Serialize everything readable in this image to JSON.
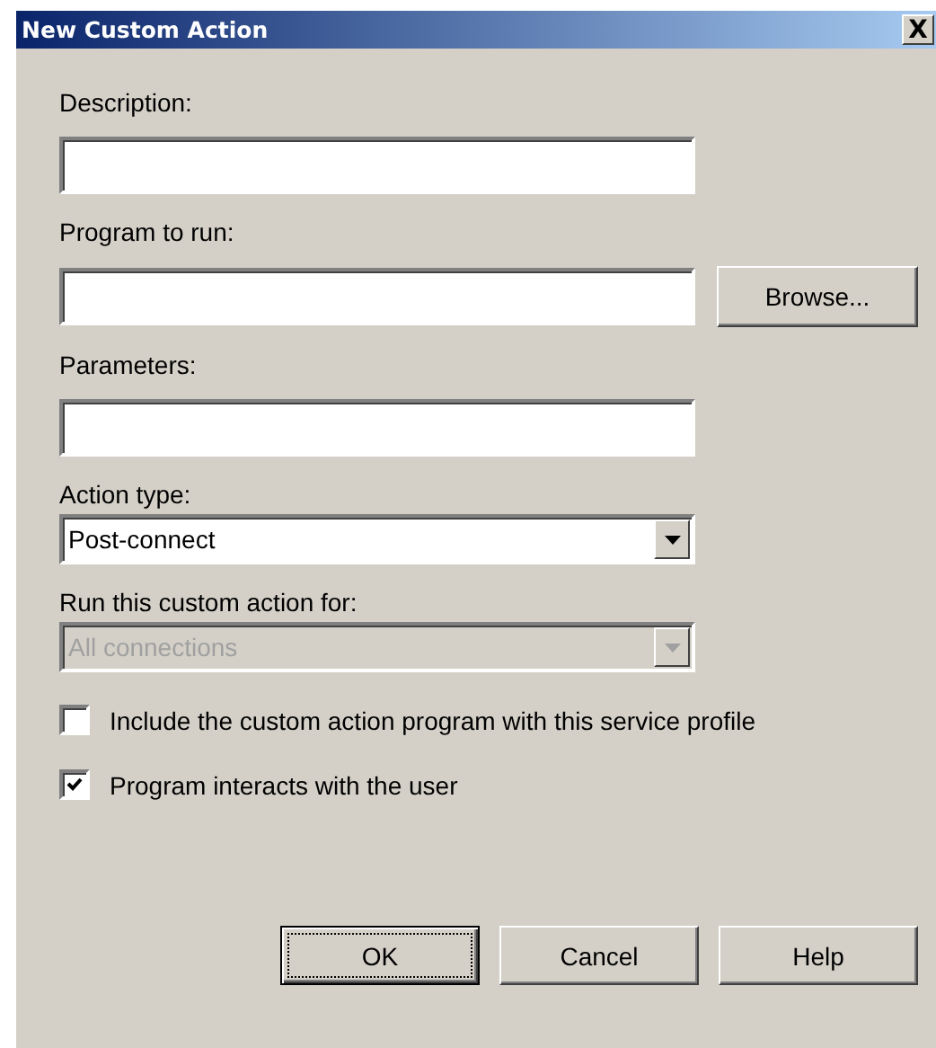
{
  "window": {
    "title": "New Custom Action",
    "close": "X"
  },
  "fields": [
    {
      "kind": "text",
      "label": "Description:"
    },
    {
      "kind": "text",
      "label": "Program to run:",
      "button": "Browse..."
    },
    {
      "kind": "text",
      "label": "Parameters:"
    },
    {
      "kind": "combo",
      "label": "Action type:",
      "value": "Post-connect",
      "disabled": false
    },
    {
      "kind": "combo",
      "label": "Run this custom action for:",
      "value": "All connections",
      "disabled": true
    }
  ],
  "checkboxes": [
    {
      "label": "Include the custom action program with this service profile",
      "checked": false
    },
    {
      "label": "Program interacts with the user",
      "checked": true
    }
  ],
  "buttons": [
    {
      "label": "OK",
      "default": true
    },
    {
      "label": "Cancel",
      "default": false
    },
    {
      "label": "Help",
      "default": false
    }
  ]
}
